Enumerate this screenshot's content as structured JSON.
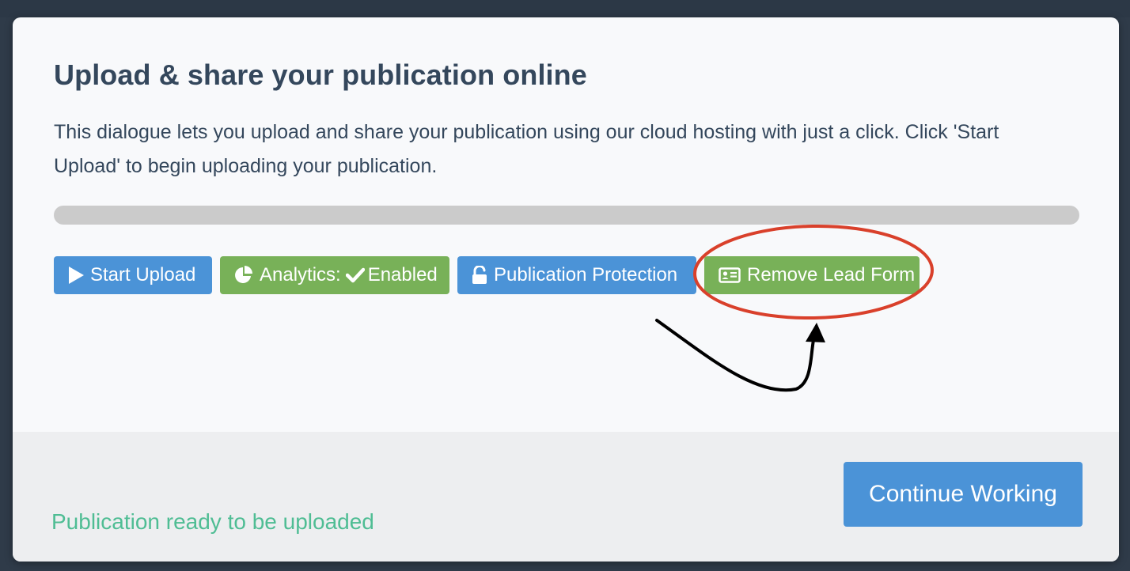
{
  "dialog": {
    "title": "Upload & share your publication online",
    "description": "This dialogue lets you upload and share your publication using our cloud hosting with just a click. Click 'Start Upload' to begin uploading your publication.",
    "progress_fraction": 0
  },
  "buttons": {
    "start_upload": {
      "label": "Start Upload",
      "icon": "play-icon",
      "color": "#4b93d7"
    },
    "analytics": {
      "label": "Analytics:",
      "status": "Enabled",
      "icon": "pie-chart-icon",
      "status_icon": "checkmark-icon",
      "color": "#78b158"
    },
    "protection": {
      "label": "Publication Protection",
      "icon": "unlock-icon",
      "color": "#4b93d7"
    },
    "lead_form": {
      "label": "Remove Lead Form",
      "icon": "id-card-icon",
      "color": "#78b158"
    }
  },
  "annotation": {
    "highlight_color": "#d9402b",
    "arrow_color": "#000000"
  },
  "footer": {
    "status_text": "Publication ready to be uploaded",
    "status_color": "#4fbd94",
    "continue_label": "Continue Working"
  }
}
